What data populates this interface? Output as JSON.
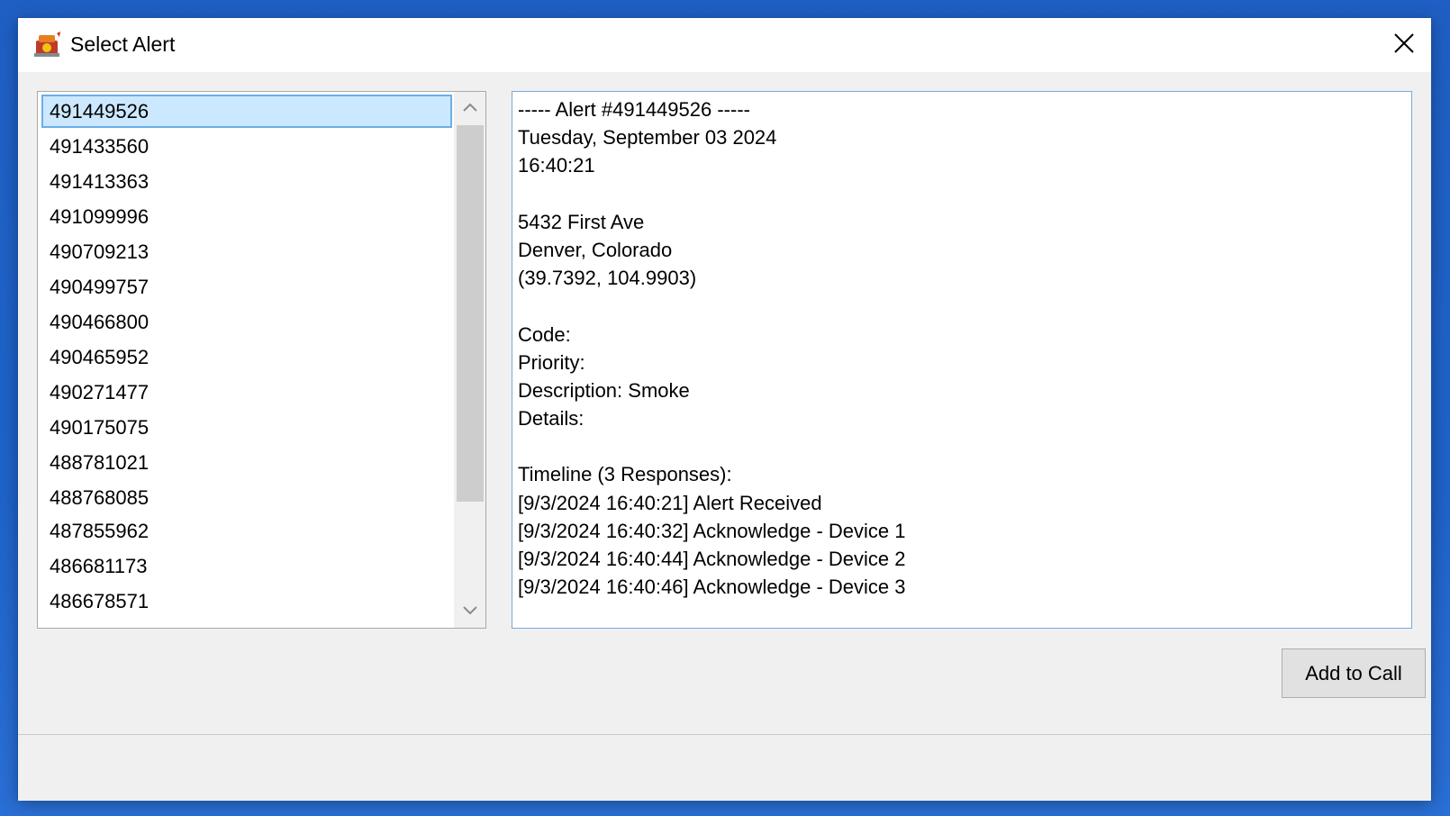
{
  "window": {
    "title": "Select Alert",
    "icon": "fire-alarm-app-icon",
    "close_icon": "close-icon"
  },
  "alert_list": {
    "selected_index": 0,
    "items": [
      "491449526",
      "491433560",
      "491413363",
      "491099996",
      "490709213",
      "490499757",
      "490466800",
      "490465952",
      "490271477",
      "490175075",
      "488781021",
      "488768085",
      "487855962",
      "486681173",
      "486678571"
    ],
    "scroll_up_icon": "chevron-up-icon",
    "scroll_down_icon": "chevron-down-icon"
  },
  "details": {
    "lines": [
      "----- Alert #491449526 -----",
      "Tuesday, September 03 2024",
      "16:40:21",
      "",
      "5432 First Ave",
      "Denver, Colorado",
      "(39.7392, 104.9903)",
      "",
      "Code:",
      "Priority:",
      "Description: Smoke",
      "Details:",
      "",
      "Timeline (3 Responses):",
      "[9/3/2024 16:40:21] Alert Received",
      "[9/3/2024 16:40:32] Acknowledge - Device 1",
      "[9/3/2024 16:40:44] Acknowledge - Device 2",
      "[9/3/2024 16:40:46] Acknowledge - Device 3"
    ]
  },
  "actions": {
    "add_to_call_label": "Add to Call"
  },
  "colors": {
    "desktop": "#1f5fc4",
    "selection_bg": "#cce8ff",
    "selection_border": "#6aaee8",
    "details_border": "#7aa7e0"
  }
}
